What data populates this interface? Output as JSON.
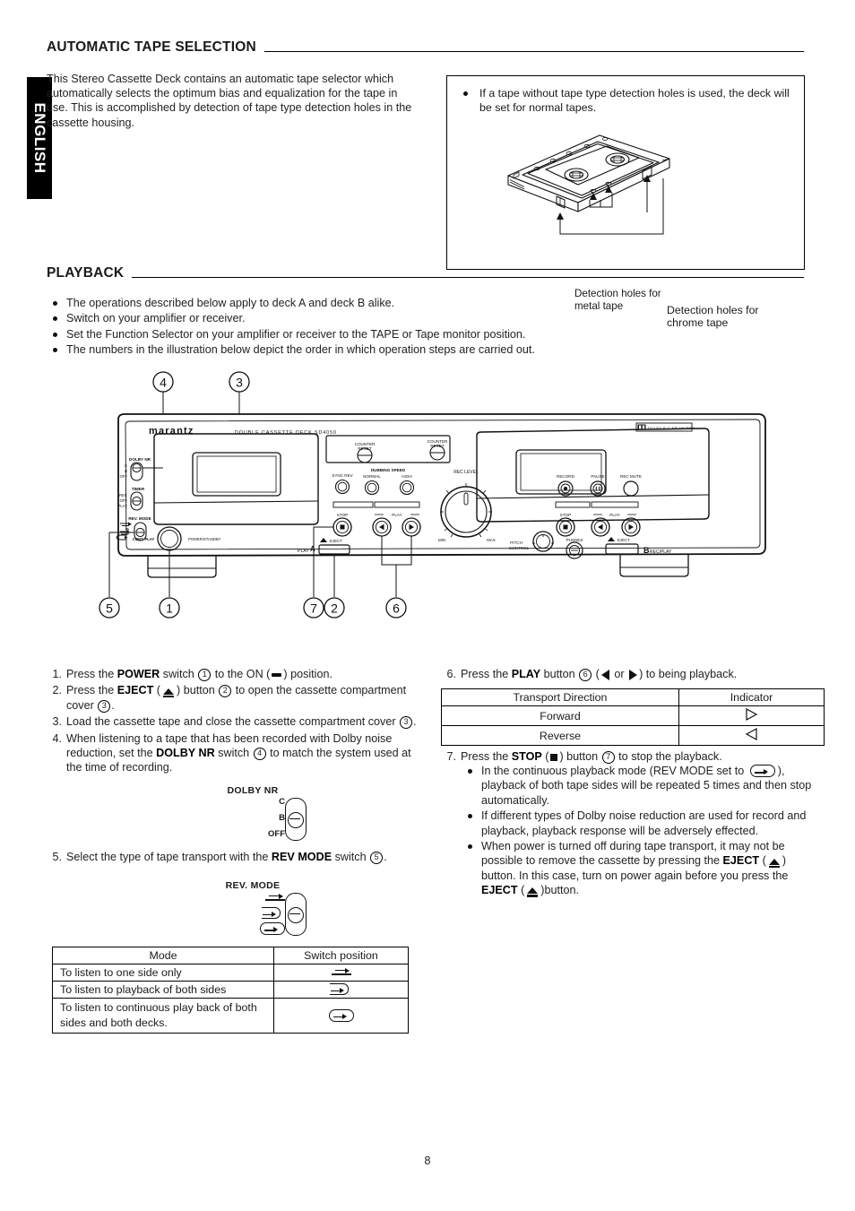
{
  "language_tab": "ENGLISH",
  "page_number": "8",
  "sections": {
    "tape_selection": {
      "heading": "AUTOMATIC TAPE SELECTION",
      "intro": "This Stereo Cassette Deck contains an automatic tape selector which automatically selects the optimum bias and equalization for the tape in use. This is accomplished by detection of tape type detection holes in the cassette housing.",
      "note_box": {
        "bullet": "If a tape without tape type detection holes is used, the deck will be set for normal tapes.",
        "label_metal": "Detection holes for metal tape",
        "label_chrome": "Detection holes for chrome tape"
      }
    },
    "playback": {
      "heading": "PLAYBACK",
      "bullets": [
        "The operations described below apply to deck A and deck B alike.",
        "Switch on your amplifier or receiver.",
        "Set the Function Selector on your amplifier or receiver to the TAPE or Tape monitor position.",
        "The numbers in the illustration below depict the order in which operation steps are carried out."
      ]
    }
  },
  "steps_left": {
    "s1": {
      "num": "1.",
      "a": "Press the ",
      "b1": "POWER",
      "c": " switch ",
      "call": "1",
      "d": " to the ON (",
      "e": ") position."
    },
    "s2": {
      "num": "2.",
      "a": "Press the ",
      "b1": "EJECT",
      "c": " (",
      "d": ") button ",
      "call": "2",
      "e": " to open the cassette compartment cover ",
      "call2": "3",
      "f": "."
    },
    "s3": {
      "num": "3.",
      "a": "Load the cassette tape and close the cassette compartment cover ",
      "call": "3",
      "b": "."
    },
    "s4": {
      "num": "4.",
      "a": "When listening to a tape that has been recorded with Dolby noise reduction, set the ",
      "b1": "DOLBY NR",
      "c": " switch ",
      "call": "4",
      "d": " to match the system used at the time of recording."
    },
    "s5": {
      "num": "5.",
      "a": "Select the type of tape transport with the ",
      "b1": "REV MODE",
      "c": " switch ",
      "call": "5",
      "d": "."
    }
  },
  "steps_right": {
    "s6": {
      "num": "6.",
      "a": "Press the ",
      "b1": "PLAY",
      "c": " button ",
      "call": "6",
      "d": " (",
      "e": " or ",
      "f": ") to being playback."
    },
    "s7": {
      "num": "7.",
      "a": "Press the ",
      "b1": "STOP",
      "c": " (",
      "d": ") button ",
      "call": "7",
      "e": " to stop the playback."
    },
    "notes": [
      {
        "a": "In the continuous playback mode (REV MODE set to ",
        "b": "), playback of both tape sides will be repeated 5 times and then stop automatically."
      },
      {
        "a": "If different types of Dolby noise reduction are used for record and playback, playback response will be adversely effected.",
        "b": ""
      },
      {
        "a": "When power is turned off during tape transport, it may not be possible to remove the cassette by pressing the ",
        "b1": "EJECT",
        "c": " (",
        "d": ") button. In this case, turn on power again before you press the ",
        "b2": "EJECT",
        "e": " (",
        "f": ")button."
      }
    ]
  },
  "figures": {
    "dolby_nr": {
      "caption": "DOLBY NR",
      "positions": [
        "C",
        "B",
        "OFF"
      ]
    },
    "rev_mode": {
      "caption": "REV. MODE",
      "positions": [
        "one-side-icon",
        "both-sides-icon",
        "continuous-icon"
      ]
    }
  },
  "table_mode": {
    "headers": [
      "Mode",
      "Switch position"
    ],
    "rows": [
      {
        "mode": "To listen to one side only",
        "icon": "one-side-icon"
      },
      {
        "mode": "To listen to playback of both sides",
        "icon": "both-sides-icon"
      },
      {
        "mode": "To listen to continuous play back of both sides and both decks.",
        "icon": "continuous-icon"
      }
    ]
  },
  "table_direction": {
    "headers": [
      "Transport Direction",
      "Indicator"
    ],
    "rows": [
      {
        "direction": "Forward",
        "indicator": "triangle-right-outline"
      },
      {
        "direction": "Reverse",
        "indicator": "triangle-left-outline"
      }
    ]
  },
  "deck": {
    "brand": "marantz",
    "model_line": "DOUBLE  CASSETTE  DECK  SD4050",
    "dolby_badge": "DOLBY B-C NR HX PRO",
    "controls": {
      "dolby_nr": {
        "caption": "DOLBY NR",
        "positions": [
          "C",
          "B",
          "OFF"
        ]
      },
      "timer": {
        "caption": "TIMER",
        "positions": [
          "REC",
          "OFF",
          "PLAY"
        ]
      },
      "rev_mode": {
        "caption": "REV. MODE",
        "bottom_label": "CONT. PLAY"
      },
      "power": "POWER/STANDBY",
      "counter_reset_a": "COUNTER RESET",
      "counter_reset_b": "COUNTER RESET",
      "sync_rev": "SYNC REV",
      "dubbing_speed": {
        "caption": "DUBBING SPEED",
        "options": [
          "NORMAL",
          "HIGH"
        ]
      },
      "rec_level": {
        "caption": "REC LEVEL",
        "min": "MIN",
        "max": "MAX"
      },
      "record": "RECORD",
      "pause": "PAUSE",
      "rec_mute": "REC MUTE",
      "stop_a": "STOP",
      "play_a": "PLAY",
      "stop_b": "STOP",
      "play_b": "PLAY",
      "pitch_control": "PITCH CONTROL",
      "phones": "PHONES",
      "eject_a": "EJECT",
      "eject_b": "EJECT",
      "deck_a_label": "A",
      "deck_a_sub": "PLAY",
      "deck_b_label": "B",
      "deck_b_sub": "REC/PLAY"
    },
    "callouts_top": [
      "4",
      "3"
    ],
    "callouts_bottom": [
      "5",
      "1",
      "7",
      "2",
      "6"
    ]
  }
}
